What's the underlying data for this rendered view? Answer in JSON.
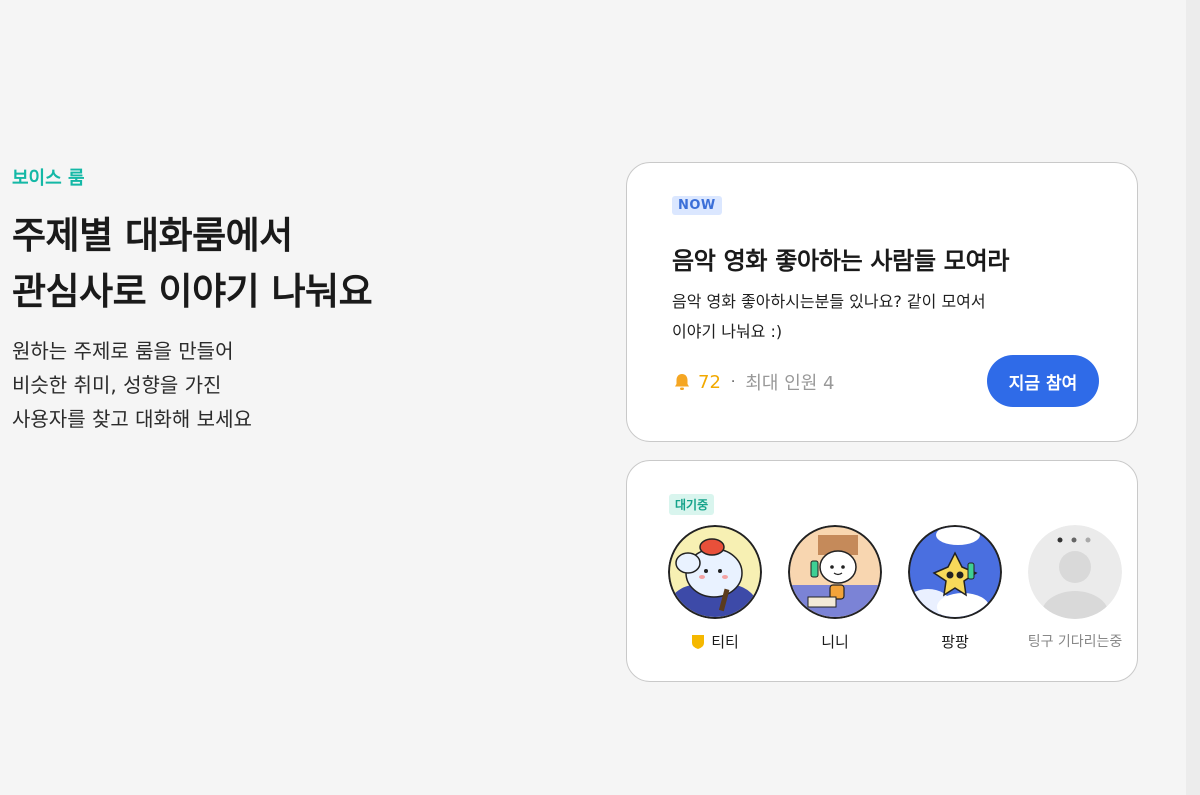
{
  "hero": {
    "eyebrow": "보이스 룸",
    "headline_line1": "주제별 대화룸에서",
    "headline_line2": "관심사로 이야기 나눠요",
    "desc_line1": "원하는 주제로 룸을 만들어",
    "desc_line2": "비슷한 취미, 성향을 가진",
    "desc_line3": "사용자를 찾고 대화해 보세요"
  },
  "room": {
    "badge": "NOW",
    "title": "음악 영화 좋아하는 사람들 모여라",
    "desc_line1": "음악 영화 좋아하시는분들 있나요? 같이 모여서",
    "desc_line2": "이야기 나눠요 :)",
    "count": "72",
    "separator": "·",
    "capacity": "최대 인원 4",
    "join_label": "지금 참여",
    "bell_icon": "bell-icon"
  },
  "waiting": {
    "badge": "대기중",
    "users": [
      {
        "name": "티티",
        "host": true
      },
      {
        "name": "니니",
        "host": false
      },
      {
        "name": "팡팡",
        "host": false
      },
      {
        "name": "팅구 기다리는중",
        "host": false
      }
    ]
  },
  "colors": {
    "accent": "#2f6be8",
    "teal": "#14b8a6",
    "count": "#f2a900"
  }
}
